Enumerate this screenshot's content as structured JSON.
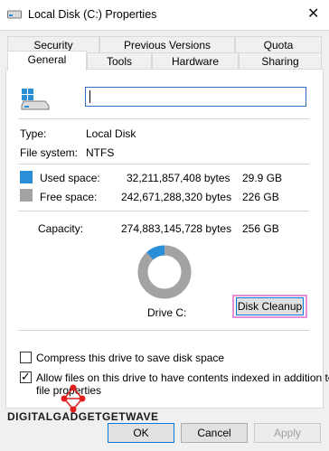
{
  "window": {
    "title": "Local Disk (C:) Properties",
    "close_glyph": "✕"
  },
  "tabs": {
    "row1": [
      "Security",
      "Previous Versions",
      "Quota"
    ],
    "row2": [
      "General",
      "Tools",
      "Hardware",
      "Sharing"
    ],
    "active": "General"
  },
  "general": {
    "drive_name_value": "",
    "type_label": "Type:",
    "type_value": "Local Disk",
    "fs_label": "File system:",
    "fs_value": "NTFS",
    "used_label": "Used space:",
    "used_bytes": "32,211,857,408 bytes",
    "used_gb": "29.9 GB",
    "free_label": "Free space:",
    "free_bytes": "242,671,288,320 bytes",
    "free_gb": "226 GB",
    "capacity_label": "Capacity:",
    "capacity_bytes": "274,883,145,728 bytes",
    "capacity_gb": "256 GB",
    "drive_label": "Drive C:",
    "disk_cleanup_label": "Disk Cleanup",
    "used_fraction": 0.117,
    "compress_label": "Compress this drive to save disk space",
    "compress_checked": false,
    "index_label_line1": "Allow files on this drive to have contents indexed in addition to",
    "index_label_line2": "file properties",
    "index_checked": true
  },
  "colors": {
    "used": "#2a8fd6",
    "free": "#a3a3a3",
    "accent": "#0078d7",
    "highlight": "#e88ed6"
  },
  "footer": {
    "ok_label": "OK",
    "cancel_label": "Cancel",
    "apply_label": "Apply"
  },
  "watermark": {
    "text": "DIGITALGADGETGETWAVE"
  }
}
